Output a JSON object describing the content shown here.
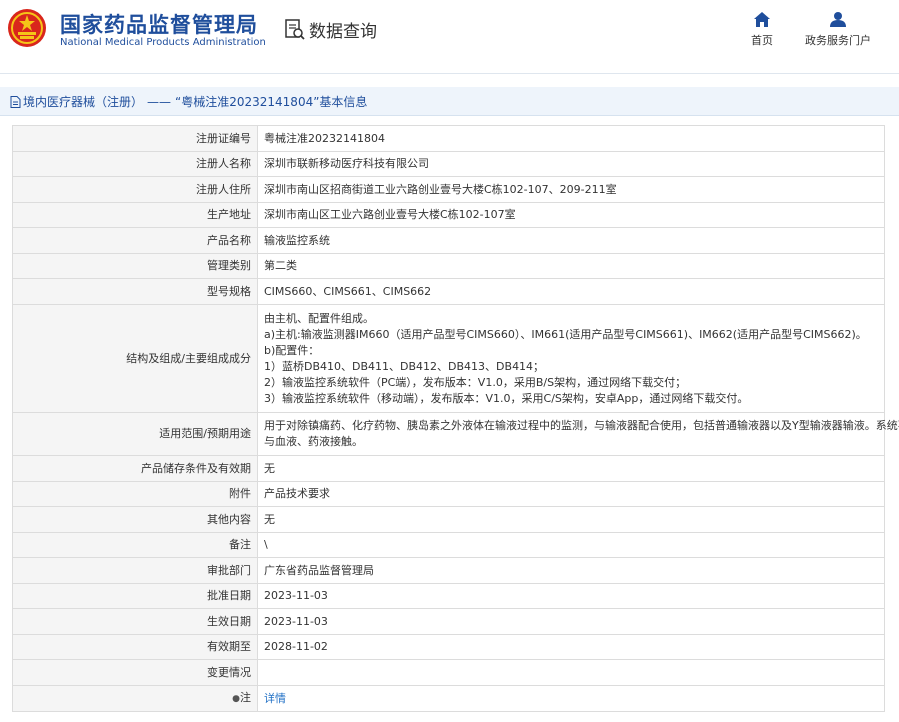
{
  "header": {
    "agency_cn": "国家药品监督管理局",
    "agency_en": "National Medical Products Administration",
    "query_title": "数据查询",
    "nav": {
      "home": "首页",
      "portal": "政务服务门户"
    }
  },
  "breadcrumb": {
    "category": "境内医疗器械（注册）",
    "separator": "——",
    "subject": "“粤械注准20232141804”基本信息"
  },
  "rows": [
    {
      "label": "注册证编号",
      "value": "粤械注准20232141804"
    },
    {
      "label": "注册人名称",
      "value": "深圳市联新移动医疗科技有限公司"
    },
    {
      "label": "注册人住所",
      "value": "深圳市南山区招商街道工业六路创业壹号大楼C栋102-107、209-211室"
    },
    {
      "label": "生产地址",
      "value": "深圳市南山区工业六路创业壹号大楼C栋102-107室"
    },
    {
      "label": "产品名称",
      "value": "输液监控系统"
    },
    {
      "label": "管理类别",
      "value": "第二类"
    },
    {
      "label": "型号规格",
      "value": "CIMS660、CIMS661、CIMS662"
    },
    {
      "label": "结构及组成/主要组成成分",
      "lines": [
        "由主机、配置件组成。",
        "a)主机:输液监测器IM660（适用产品型号CIMS660）、IM661(适用产品型号CIMS661)、IM662(适用产品型号CIMS662)。",
        "b)配置件：",
        "1）蓝桥DB410、DB411、DB412、DB413、DB414；",
        "2）输液监控系统软件（PC端），发布版本：V1.0，采用B/S架构，通过网络下载交付；",
        "3）输液监控系统软件（移动端），发布版本：V1.0，采用C/S架构，安卓App，通过网络下载交付。"
      ]
    },
    {
      "label": "适用范围/预期用途",
      "lines": [
        "用于对除镇痛药、化疗药物、胰岛素之外液体在输液过程中的监测，与输液器配合使用，包括普通输液器以及Y型输液器输液。系统不",
        "与血液、药液接触。"
      ]
    },
    {
      "label": "产品储存条件及有效期",
      "value": "无"
    },
    {
      "label": "附件",
      "value": "产品技术要求"
    },
    {
      "label": "其他内容",
      "value": "无"
    },
    {
      "label": "备注",
      "value": "\\"
    },
    {
      "label": "审批部门",
      "value": "广东省药品监督管理局"
    },
    {
      "label": "批准日期",
      "value": "2023-11-03"
    },
    {
      "label": "生效日期",
      "value": "2023-11-03"
    },
    {
      "label": "有效期至",
      "value": "2028-11-02"
    },
    {
      "label": "变更情况",
      "value": ""
    },
    {
      "label": "注",
      "value": "详情"
    }
  ],
  "colors": {
    "brand": "#1f4e9c",
    "link": "#1f6fc5",
    "label_bg": "#f5f5f5",
    "crumb_bg": "#eef4fb"
  }
}
